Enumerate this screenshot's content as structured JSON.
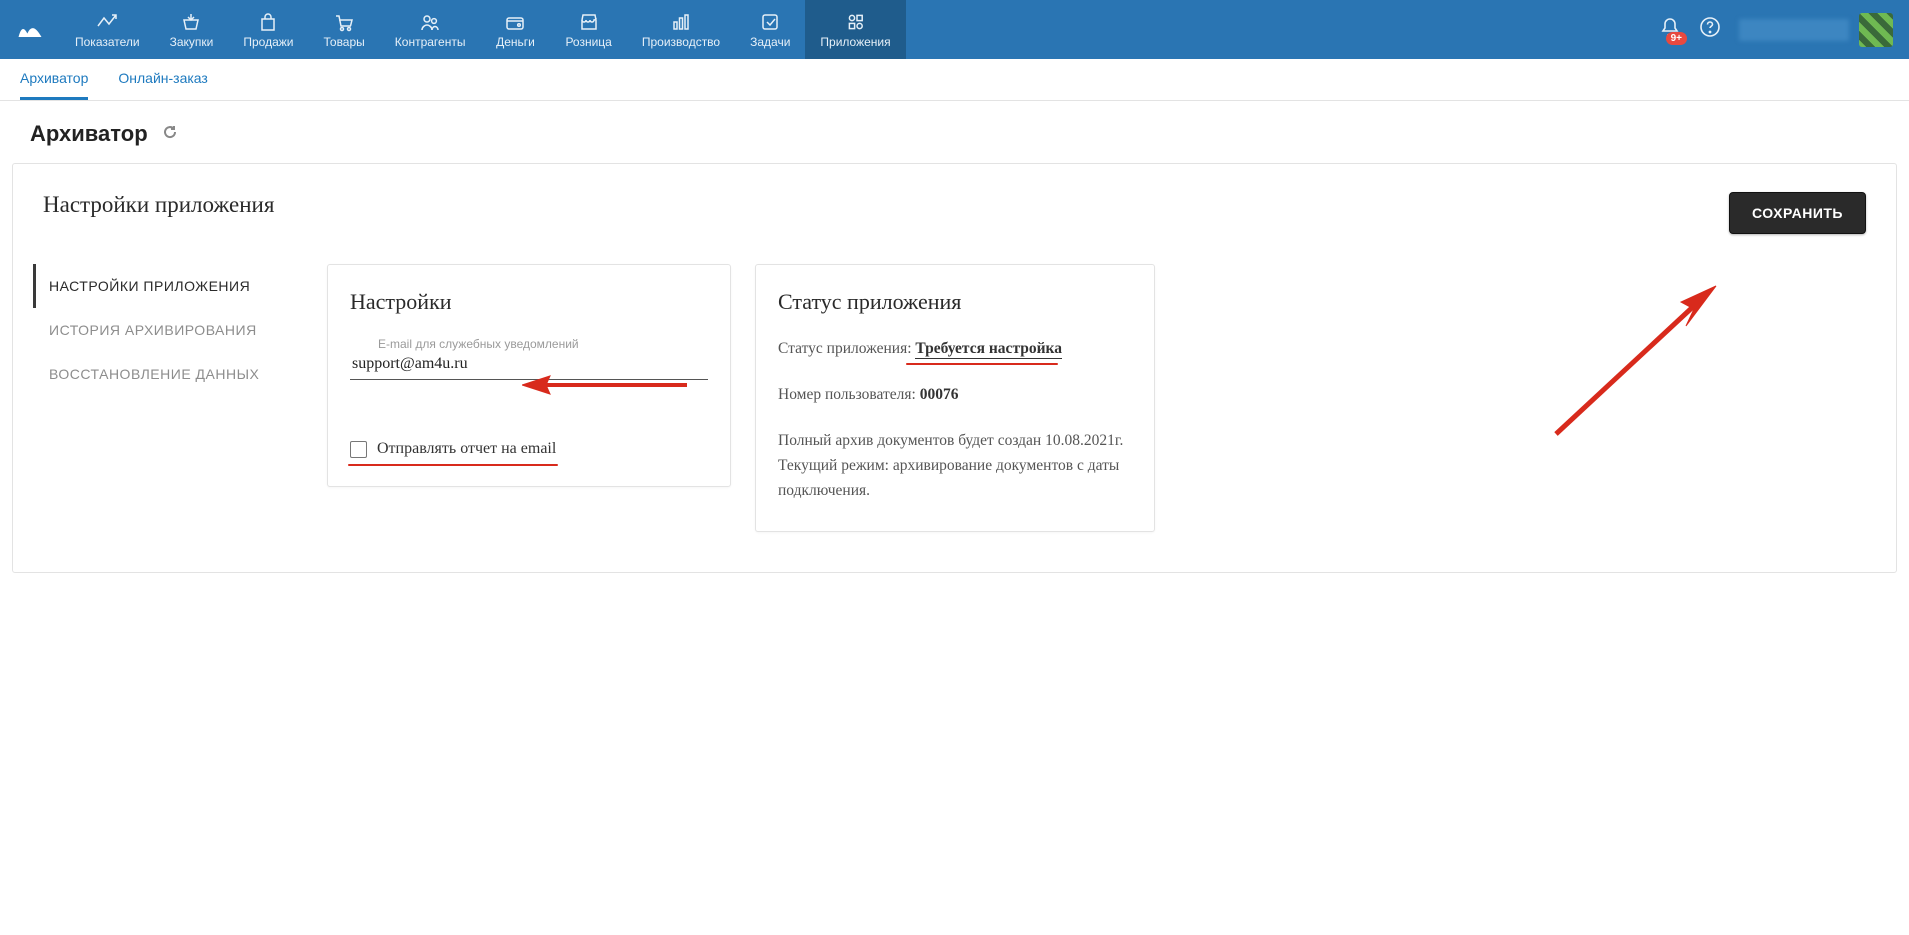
{
  "topnav": {
    "items": [
      {
        "label": "Показатели"
      },
      {
        "label": "Закупки"
      },
      {
        "label": "Продажи"
      },
      {
        "label": "Товары"
      },
      {
        "label": "Контрагенты"
      },
      {
        "label": "Деньги"
      },
      {
        "label": "Розница"
      },
      {
        "label": "Производство"
      },
      {
        "label": "Задачи"
      },
      {
        "label": "Приложения"
      }
    ],
    "badge": "9+"
  },
  "subtabs": {
    "archiver": "Архиватор",
    "online_order": "Онлайн-заказ"
  },
  "page": {
    "title": "Архиватор"
  },
  "frame": {
    "title": "Настройки приложения",
    "save_btn": "СОХРАНИТЬ",
    "side": {
      "settings": "НАСТРОЙКИ ПРИЛОЖЕНИЯ",
      "history": "ИСТОРИЯ АРХИВИРОВАНИЯ",
      "restore": "ВОССТАНОВЛЕНИЕ ДАННЫХ"
    }
  },
  "settings_card": {
    "title": "Настройки",
    "email_label": "E-mail для служебных уведомлений",
    "email_value": "support@am4u.ru",
    "checkbox_label": "Отправлять отчет на email"
  },
  "status_card": {
    "title": "Статус приложения",
    "status_prefix": "Статус приложения: ",
    "status_value": "Требуется настройка",
    "user_prefix": "Номер пользователя: ",
    "user_value": "00076",
    "desc": "Полный архив документов будет создан 10.08.2021г. Текущий режим: архивирование документов с даты подключения."
  }
}
